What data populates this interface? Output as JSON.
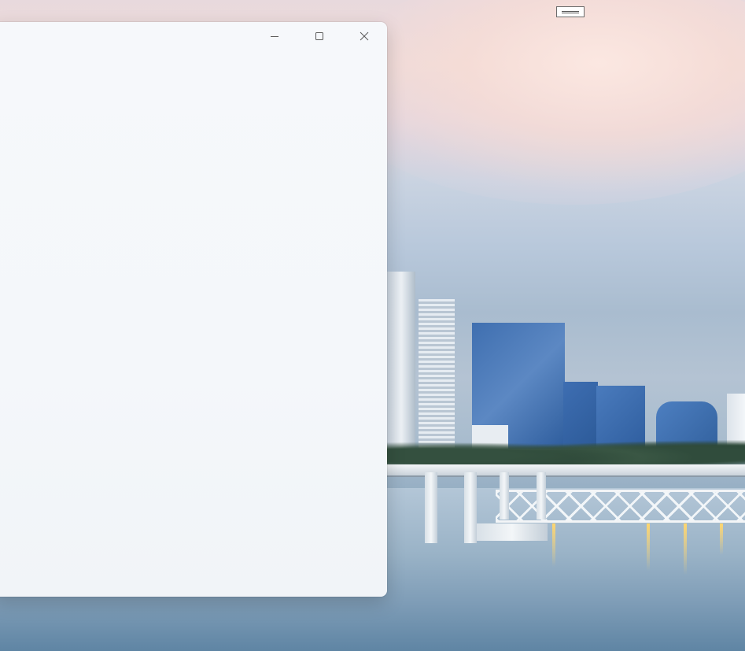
{
  "window": {
    "controls": {
      "minimize_icon": "minimize-icon",
      "maximize_icon": "maximize-icon",
      "close_icon": "close-icon"
    },
    "background": "#f5f8fb"
  },
  "desktop": {
    "wallpaper": "city-skyline-waterfront",
    "tray_indicator_icon": "drag-handle-icon"
  },
  "colors": {
    "sky_top": "#e8d9dd",
    "sky_mid": "#b8c8db",
    "water": "#7f9db7",
    "window_bg": "#f5f8fb",
    "caption_glyph": "#5a5a5a"
  }
}
